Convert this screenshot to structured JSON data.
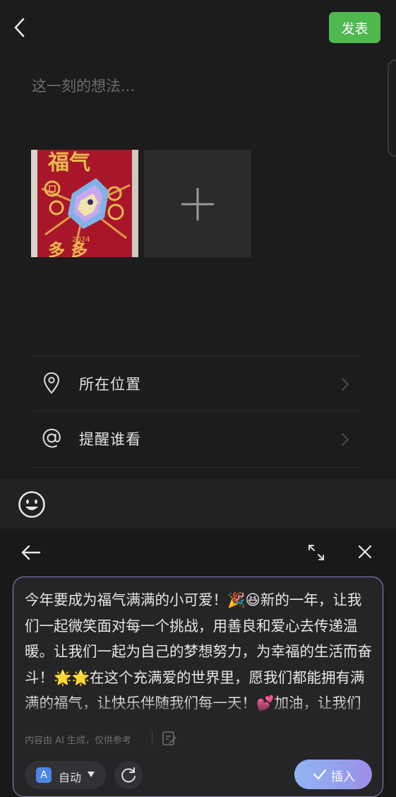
{
  "header": {
    "publish_label": "发表"
  },
  "compose": {
    "placeholder": "这一刻的想法..."
  },
  "photo": {
    "top_text": "福气",
    "year": "2024",
    "bottom_text": "多 多"
  },
  "options": [
    {
      "icon": "location-pin-icon",
      "label": "所在位置"
    },
    {
      "icon": "at-sign-icon",
      "label": "提醒谁看"
    }
  ],
  "ai_panel": {
    "generated_text": "今年要成为福气满满的小可爱！🎉😆新的一年，让我们一起微笑面对每一个挑战，用善良和爱心去传递温暖。让我们一起为自己的梦想努力，为幸福的生活而奋斗！🌟🌟在这个充满爱的世界里，愿我们都能拥有满满的福气，让快乐伴随我们每一天！💕加油，让我们一起努力",
    "disclaimer": "内容由 AI 生成，仅供参考",
    "mode_badge": "A",
    "mode_label": "自动",
    "insert_label": "插入"
  },
  "colors": {
    "accent_green": "#4fb84f",
    "background": "#1c1c1c",
    "ai_border": "#8e88c4",
    "insert_gradient_start": "#8fb6f2",
    "insert_gradient_end": "#9b8fe8"
  }
}
